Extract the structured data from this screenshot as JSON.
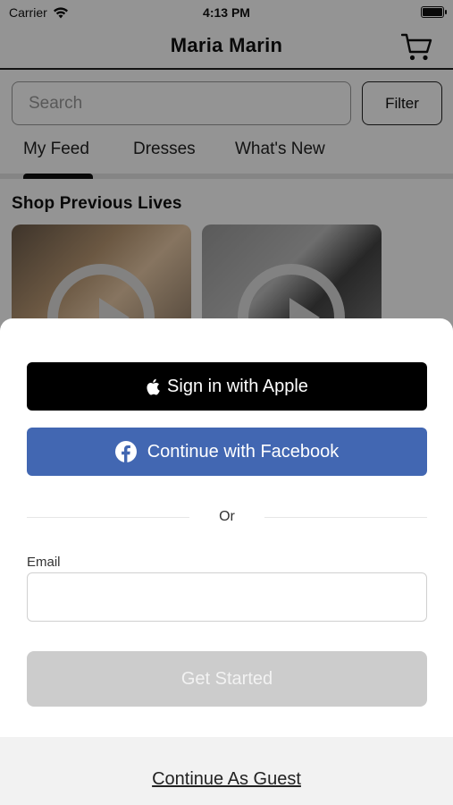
{
  "status_bar": {
    "carrier": "Carrier",
    "time": "4:13 PM"
  },
  "nav": {
    "title": "Maria Marin",
    "cart_icon": "shopping-cart-icon"
  },
  "search": {
    "placeholder": "Search",
    "filter_label": "Filter"
  },
  "tabs": [
    {
      "label": "My Feed",
      "selected": true
    },
    {
      "label": "Dresses",
      "selected": false
    },
    {
      "label": "What's New",
      "selected": false
    }
  ],
  "section": {
    "title": "Shop Previous Lives"
  },
  "sheet": {
    "apple_label": "Sign in with Apple",
    "facebook_label": "Continue with Facebook",
    "or_text": "Or",
    "email_label": "Email",
    "email_value": "",
    "get_started_label": "Get Started",
    "guest_label": "Continue As Guest"
  },
  "colors": {
    "facebook_blue": "#4267b2",
    "apple_black": "#000000",
    "disabled_gray": "#cccccc"
  }
}
